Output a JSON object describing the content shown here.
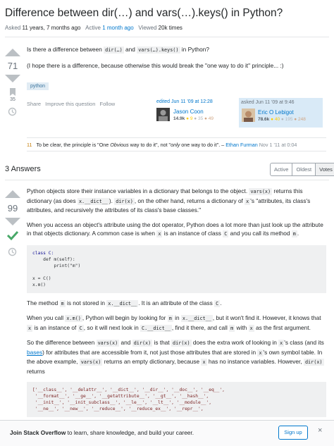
{
  "question": {
    "title": "Difference between dir(…) and vars(…).keys() in Python?",
    "asked_label": "Asked",
    "asked_value": "11 years, 7 months ago",
    "active_label": "Active",
    "active_value": "1 month ago",
    "viewed_label": "Viewed",
    "viewed_value": "20k times",
    "votes": "71",
    "bookmarks": "35",
    "body_1a": "Is there a difference between ",
    "code_dir": "dir(…)",
    "body_1b": " and ",
    "code_vars": "vars(…).keys()",
    "body_1c": " in Python?",
    "body_2": "(I hope there is a difference, because otherwise this would break the \"one way to do it\" principle... :)",
    "tag": "python",
    "menu": [
      "Share",
      "Improve this question",
      "Follow"
    ],
    "editor": {
      "when": "edited Jun 11 '09 at 12:28",
      "name": "Jason Coon",
      "rep": "14.9k",
      "gold": "● 9",
      "silver": "● 35",
      "bronze": "● 49"
    },
    "asker": {
      "when": "asked Jun 11 '09 at 9:46",
      "name": "Eric O Lebigot",
      "rep": "78.6k",
      "gold": "● 40",
      "silver": "● 195",
      "bronze": "● 248"
    }
  },
  "comment": {
    "score": "11",
    "text_a": "To be clear, the principle is \"One ",
    "text_em": "Obvious",
    "text_b": " way to do it\", not \"",
    "text_em2": "only",
    "text_c": " one way to do it\". – ",
    "author": "Ethan Furman",
    "date": "Nov 1 '11 at 0:04"
  },
  "answers_header": {
    "count_label": "3 Answers",
    "tabs": [
      "Active",
      "Oldest",
      "Votes"
    ]
  },
  "answer": {
    "votes": "99",
    "p1a": "Python objects store their instance variables in a dictionary that belongs to the object. ",
    "p1code": "vars(x)",
    "p1b": " returns this dictionary (as does ",
    "p1code2": "x.__dict__",
    "p1c": "). ",
    "p1code3": "dir(x)",
    "p1d": ", on the other hand, returns a dictionary of ",
    "p1code4": "x",
    "p1e": "'s \"attributes, its class's attributes, and recursively the attributes of its class's base classes.\"",
    "p2a": "When you access an object's attribute using the dot operator, Python does a lot more than just look up the attribute in that objects dictionary. A common case is when ",
    "p2code": "x",
    "p2b": " is an instance of class ",
    "p2code2": "C",
    "p2c": " and you call its method ",
    "p2code3": "m",
    "p2d": ".",
    "code_block": [
      "class C:",
      "    def m(self):",
      "        print(\"m\")",
      "",
      "x = C()",
      "x.m()"
    ],
    "p3a": "The method ",
    "p3code": "m",
    "p3b": " is not stored in ",
    "p3code2": "x.__dict__",
    "p3c": ". It is an attribute of the class ",
    "p3code3": "C",
    "p3d": ".",
    "p4a": "When you call ",
    "p4code": "x.m()",
    "p4b": ", Python will begin by looking for ",
    "p4code2": "m",
    "p4c": " in ",
    "p4code3": "x.__dict__",
    "p4d": ", but it won't find it. However, it knows that ",
    "p4code4": "x",
    "p4e": " is an instance of ",
    "p4code5": "C",
    "p4f": ", so it will next look in ",
    "p4code6": "C.__dict__",
    "p4g": ", find it there, and call ",
    "p4code7": "m",
    "p4h": " with ",
    "p4code8": "x",
    "p4i": " as the first argument.",
    "p5a": "So the difference between ",
    "p5code": "vars(x)",
    "p5b": " and ",
    "p5code2": "dir(x)",
    "p5c": " is that ",
    "p5code3": "dir(x)",
    "p5d": " does the extra work of looking in ",
    "p5code4": "x",
    "p5e": "'s class (and its ",
    "p5link": "bases",
    "p5f": ") for attributes that are accessible from it, not just those attributes that are stored in ",
    "p5code5": "x",
    "p5g": "'s own symbol table. In the above example, ",
    "p5code6": "vars(x)",
    "p5h": " returns an empty dictionary, because ",
    "p5code7": "x",
    "p5i": " has no instance variables. However, ",
    "p5code8": "dir(x)",
    "p5j": " returns",
    "code_block2": [
      "['__class__', '__delattr__', '__dict__', '__dir__', '__doc__', '__eq__',",
      " '__format__', '__ge__', '__getattribute__', '__gt__', '__hash__',",
      " '__init__', '__init_subclass__', '__le__', '__lt__', '__module__',",
      " '__ne__', '__new__', '__reduce__', '__reduce_ex__', '__repr__',"
    ]
  },
  "banner": {
    "bold": "Join Stack Overflow",
    "rest": " to learn, share knowledge, and build your career.",
    "signup": "Sign up",
    "close": "×"
  },
  "colors": {
    "accent": "#0077cc",
    "accepted": "#48a868",
    "comment_score": "#c47a00"
  }
}
